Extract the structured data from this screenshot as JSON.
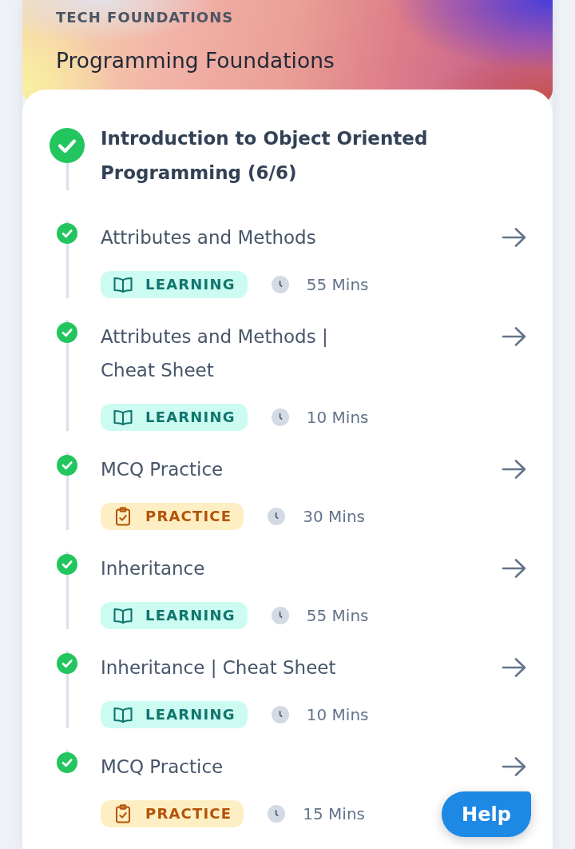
{
  "header": {
    "category": "TECH FOUNDATIONS",
    "title": "Programming Foundations"
  },
  "module": {
    "title": "Introduction to Object Oriented Programming (6/6)",
    "completed": true
  },
  "items": [
    {
      "title": "Attributes and Methods",
      "completed": true,
      "tag": {
        "kind": "learning",
        "label": "LEARNING"
      },
      "duration": "55 Mins"
    },
    {
      "title": "Attributes and Methods | Cheat Sheet",
      "completed": true,
      "tag": {
        "kind": "learning",
        "label": "LEARNING"
      },
      "duration": "10 Mins"
    },
    {
      "title": "MCQ Practice",
      "completed": true,
      "tag": {
        "kind": "practice",
        "label": "PRACTICE"
      },
      "duration": "30 Mins"
    },
    {
      "title": "Inheritance",
      "completed": true,
      "tag": {
        "kind": "learning",
        "label": "LEARNING"
      },
      "duration": "55 Mins"
    },
    {
      "title": "Inheritance | Cheat Sheet",
      "completed": true,
      "tag": {
        "kind": "learning",
        "label": "LEARNING"
      },
      "duration": "10 Mins"
    },
    {
      "title": "MCQ Practice",
      "completed": true,
      "tag": {
        "kind": "practice",
        "label": "PRACTICE"
      },
      "duration": "15 Mins"
    }
  ],
  "help_button": {
    "label": "Help"
  }
}
